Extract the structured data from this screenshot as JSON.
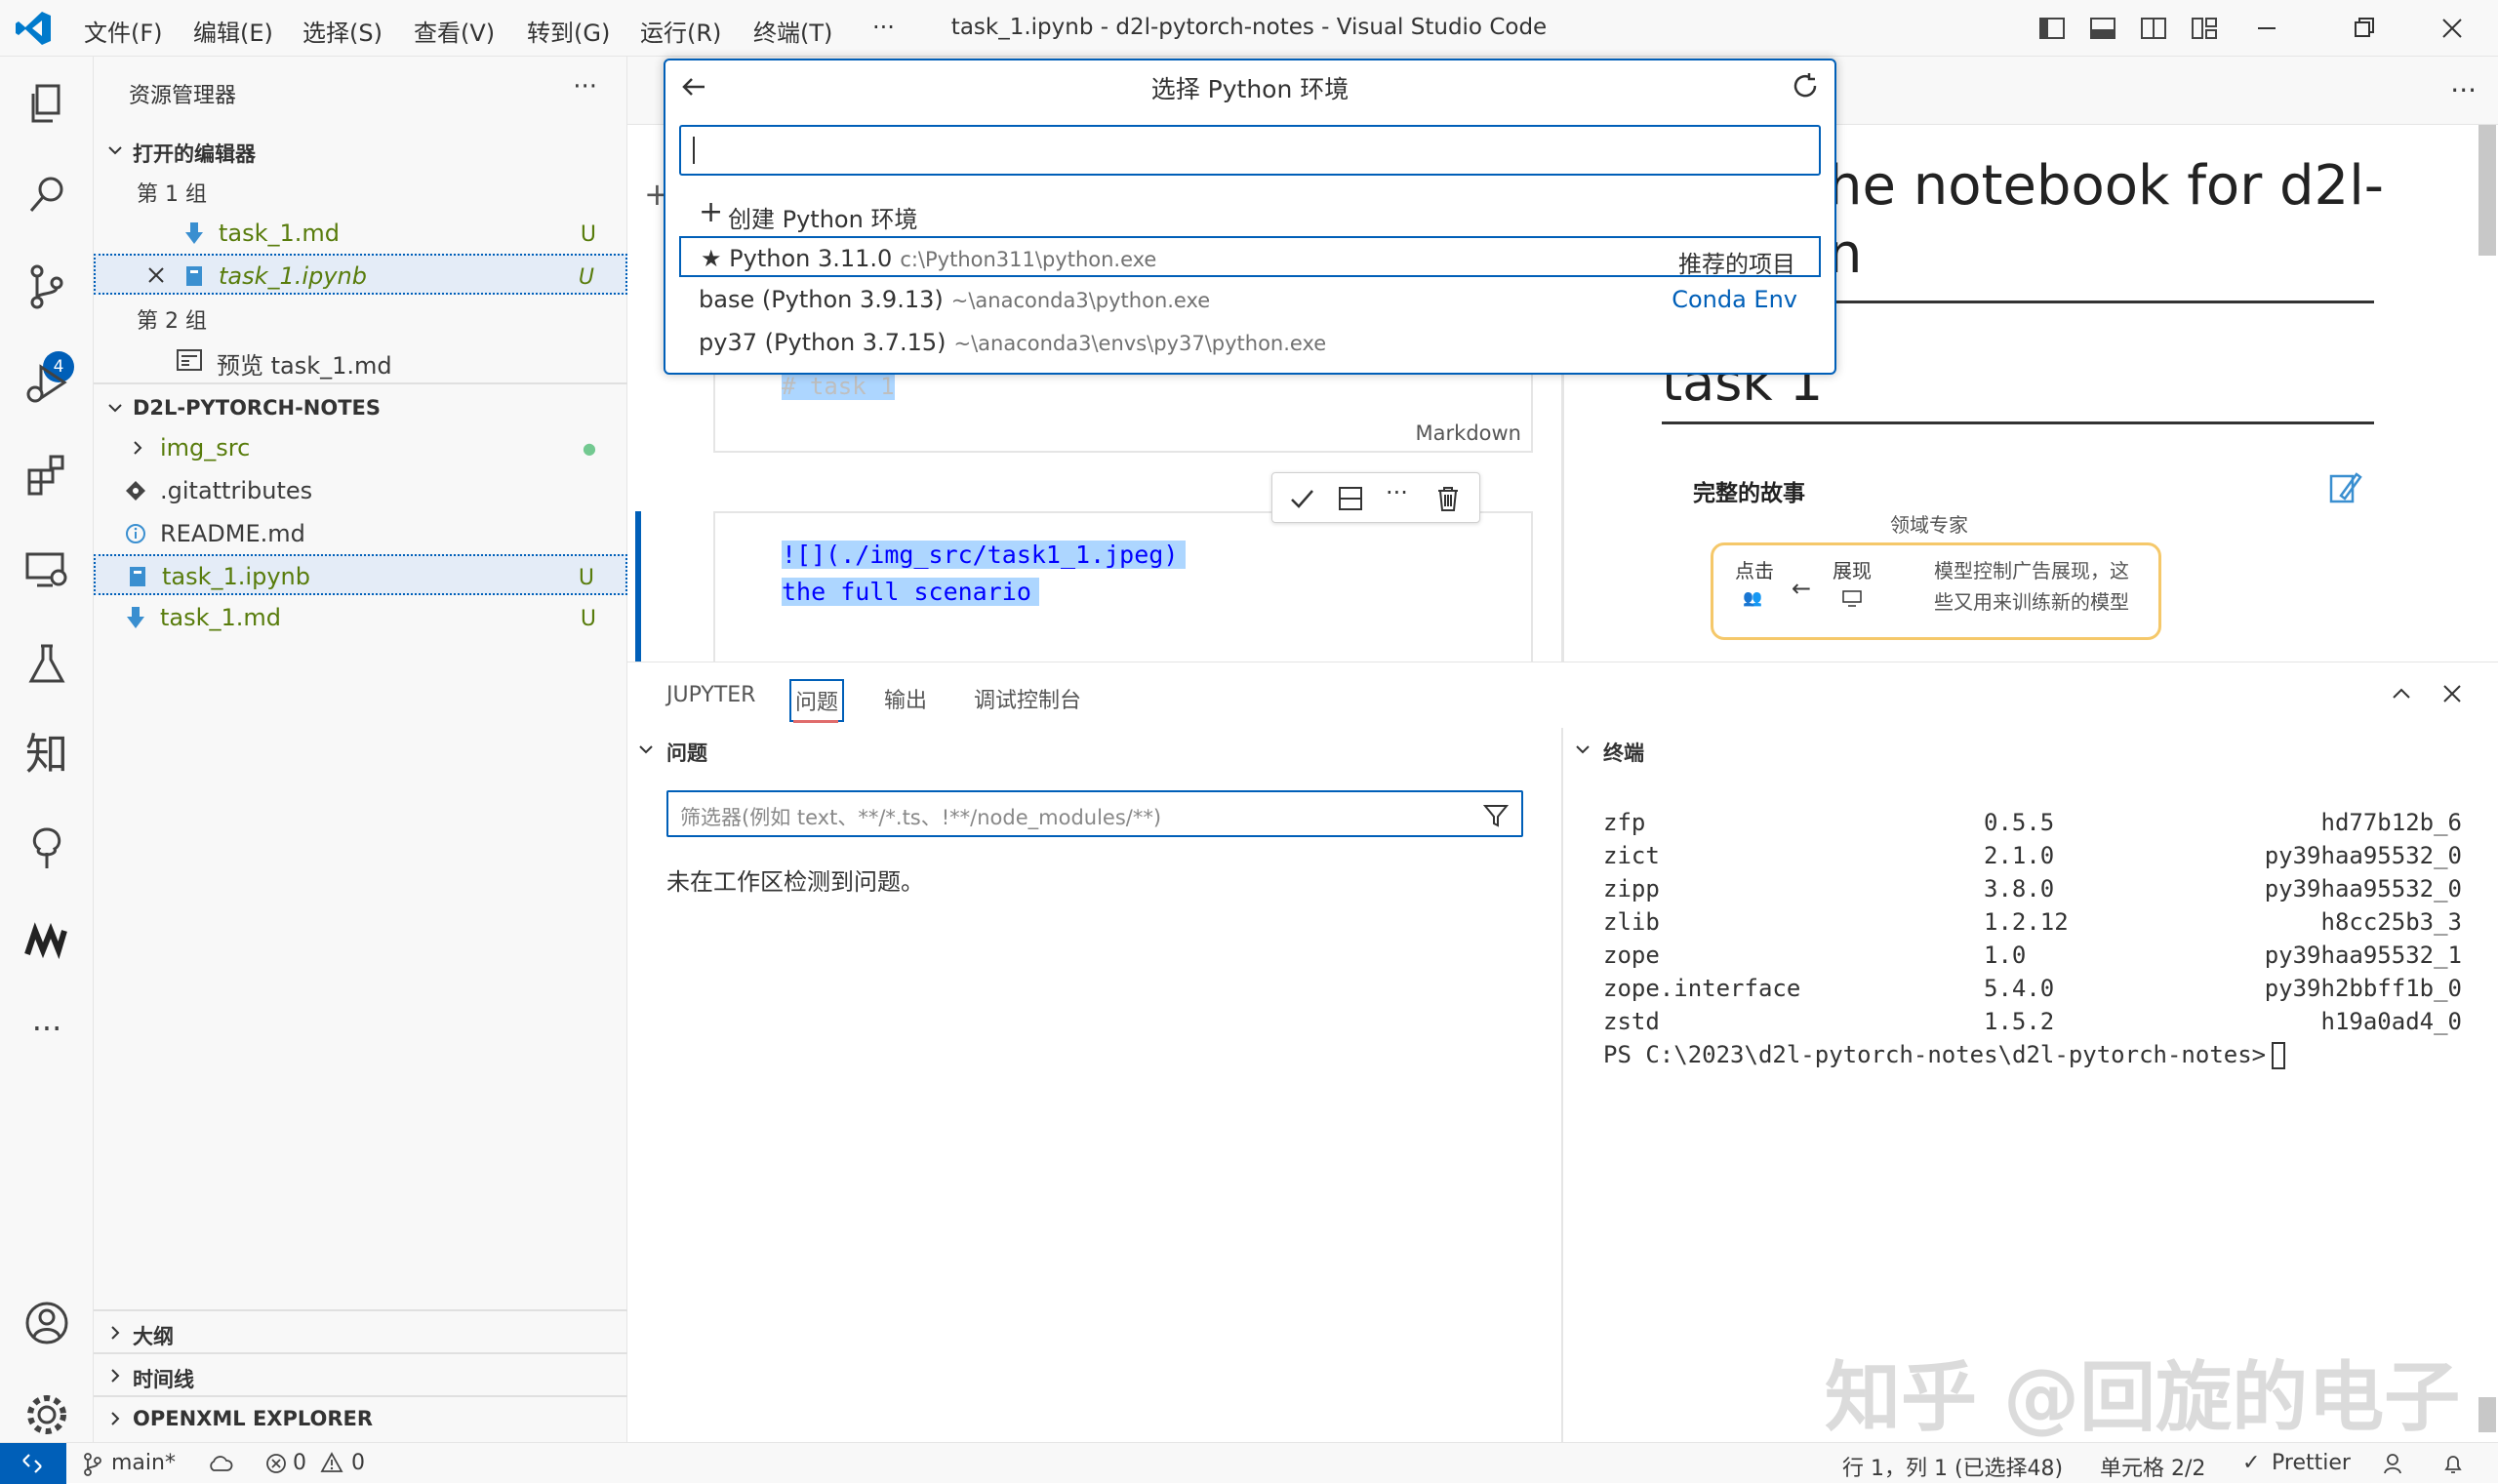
{
  "titlebar": {
    "menus": [
      "文件(F)",
      "编辑(E)",
      "选择(S)",
      "查看(V)",
      "转到(G)",
      "运行(R)",
      "终端(T)",
      "···"
    ],
    "title": "task_1.ipynb - d2l-pytorch-notes - Visual Studio Code"
  },
  "activitybar": {
    "scm_badge": "4",
    "zhihu_glyph": "知"
  },
  "sidebar": {
    "title": "资源管理器",
    "more": "···",
    "open_editors": {
      "header": "打开的编辑器",
      "group1": "第 1 组",
      "group1_items": [
        {
          "label": "task_1.md",
          "status": "U"
        },
        {
          "label": "task_1.ipynb",
          "status": "U"
        }
      ],
      "group2": "第 2 组",
      "group2_items": [
        {
          "label": "预览 task_1.md"
        }
      ]
    },
    "project": {
      "header": "D2L-PYTORCH-NOTES",
      "items": [
        {
          "label": "img_src",
          "status": "●"
        },
        {
          "label": ".gitattributes",
          "status": ""
        },
        {
          "label": "README.md",
          "status": ""
        },
        {
          "label": "task_1.ipynb",
          "status": "U"
        },
        {
          "label": "task_1.md",
          "status": "U"
        }
      ]
    },
    "outline": "大纲",
    "timeline": "时间线",
    "openxml": "OPENXML EXPLORER"
  },
  "quickpick": {
    "title": "选择 Python 环境",
    "input_value": "",
    "create": "创建 Python 环境",
    "items": [
      {
        "label": "Python 3.11.0",
        "path": "c:\\Python311\\python.exe",
        "right": "推荐的项目"
      },
      {
        "label": "base (Python 3.9.13)",
        "path": "~\\anaconda3\\python.exe",
        "right": "Conda Env"
      },
      {
        "label": "py37 (Python 3.7.15)",
        "path": "~\\anaconda3\\envs\\py37\\python.exe",
        "right": ""
      }
    ]
  },
  "notebook": {
    "cell1_code": "# task 1",
    "cell1_lang": "Markdown",
    "cell2_line1": "![](./img_src/task1_1.jpeg)",
    "cell2_line2": "the full scenario"
  },
  "preview": {
    "heading1_line1": "he notebook for d2l-",
    "heading1_line2": "n",
    "heading2": "task 1",
    "story": "完整的故事",
    "expert": "领域专家",
    "click": "点击",
    "show": "展现",
    "desc_line1": "模型控制广告展现，这",
    "desc_line2": "些又用来训练新的模型"
  },
  "panel": {
    "tabs": [
      "JUPYTER",
      "问题",
      "输出",
      "调试控制台"
    ],
    "problems_header": "问题",
    "filter_placeholder": "筛选器(例如 text、**/*.ts、!**/node_modules/**)",
    "no_problems": "未在工作区检测到问题。",
    "terminal_header": "终端",
    "terminal_rows": [
      {
        "name": "zfp",
        "version": "0.5.5",
        "build": "hd77b12b_6"
      },
      {
        "name": "zict",
        "version": "2.1.0",
        "build": "py39haa95532_0"
      },
      {
        "name": "zipp",
        "version": "3.8.0",
        "build": "py39haa95532_0"
      },
      {
        "name": "zlib",
        "version": "1.2.12",
        "build": "h8cc25b3_3"
      },
      {
        "name": "zope",
        "version": "1.0",
        "build": "py39haa95532_1"
      },
      {
        "name": "zope.interface",
        "version": "5.4.0",
        "build": "py39h2bbff1b_0"
      },
      {
        "name": "zstd",
        "version": "1.5.2",
        "build": "h19a0ad4_0"
      }
    ],
    "prompt": "PS C:\\2023\\d2l-pytorch-notes\\d2l-pytorch-notes>"
  },
  "statusbar": {
    "branch": "main*",
    "errors": "0",
    "warnings": "0",
    "position": "行 1，列 1 (已选择48)",
    "cell": "单元格 2/2",
    "prettier": "Prettier"
  },
  "watermark": "知乎 @回旋的电子",
  "colors": {
    "accent": "#005fb8",
    "git_green": "#587c0c",
    "bg": "#f8f8f8"
  }
}
